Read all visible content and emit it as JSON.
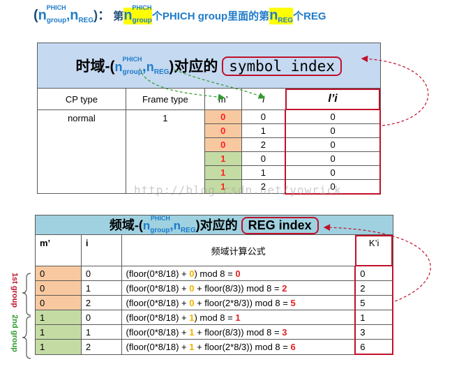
{
  "header": {
    "open_paren": "(",
    "n_letter": "n",
    "phich_sup": "PHICH",
    "group_sub": "group",
    "comma": ",",
    "reg_sub": "REG",
    "close_colon": ")：",
    "text_di1": "第",
    "text_mid": "个PHICH group里面的第",
    "text_end": "个REG"
  },
  "table1": {
    "title_prefix": "时域-(",
    "title_suffix": ")对应的",
    "title_box": "symbol index",
    "columns": [
      "CP type",
      "Frame type",
      "m’",
      "i",
      "l’i"
    ],
    "cp_type": "normal",
    "frame_type": "1",
    "rows": [
      {
        "m": "0",
        "i": "0",
        "l": "0",
        "color": "#f8c9a0"
      },
      {
        "m": "0",
        "i": "1",
        "l": "0",
        "color": "#f8c9a0"
      },
      {
        "m": "0",
        "i": "2",
        "l": "0",
        "color": "#f8c9a0"
      },
      {
        "m": "1",
        "i": "0",
        "l": "0",
        "color": "#c4dca4"
      },
      {
        "m": "1",
        "i": "1",
        "l": "0",
        "color": "#c4dca4"
      },
      {
        "m": "1",
        "i": "2",
        "l": "0",
        "color": "#c4dca4"
      }
    ]
  },
  "table2": {
    "title_prefix": "频域-(",
    "title_suffix": ")对应的",
    "title_box": "REG index",
    "columns": [
      "m’",
      "i",
      "频域计算公式",
      "K’i"
    ],
    "rows": [
      {
        "m": "0",
        "i": "0",
        "f1": "(floor(0*8/18) + ",
        "f2": "0",
        "f3": ") mod 8 = ",
        "f4": "0",
        "k": "0",
        "color": "#f8c9a0"
      },
      {
        "m": "0",
        "i": "1",
        "f1": "(floor(0*8/18) + ",
        "f2": "0",
        "f3": " + floor(8/3)) mod 8 = ",
        "f4": "2",
        "k": "2",
        "color": "#f8c9a0"
      },
      {
        "m": "0",
        "i": "2",
        "f1": "(floor(0*8/18) + ",
        "f2": "0",
        "f3": " + floor(2*8/3)) mod 8 = ",
        "f4": "5",
        "k": "5",
        "color": "#f8c9a0"
      },
      {
        "m": "1",
        "i": "0",
        "f1": "(floor(0*8/18) + ",
        "f2": "1",
        "f3": ") mod 8 = ",
        "f4": "1",
        "k": "1",
        "color": "#c4dca4"
      },
      {
        "m": "1",
        "i": "1",
        "f1": "(floor(0*8/18) + ",
        "f2": "1",
        "f3": " + floor(8/3)) mod 8 = ",
        "f4": "3",
        "k": "3",
        "color": "#c4dca4"
      },
      {
        "m": "1",
        "i": "2",
        "f1": "(floor(0*8/18) + ",
        "f2": "1",
        "f3": " + floor(2*8/3)) mod 8 = ",
        "f4": "6",
        "k": "6",
        "color": "#c4dca4"
      }
    ]
  },
  "group_labels": {
    "first": "1st group",
    "second": "2nd group"
  },
  "watermark": "http://blog.csdn.net/yowrick"
}
